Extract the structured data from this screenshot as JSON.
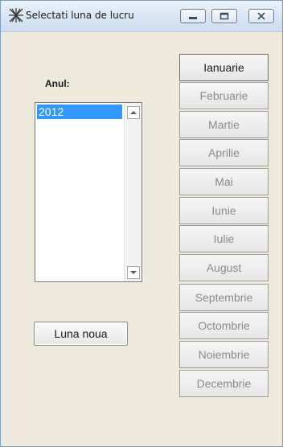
{
  "window": {
    "title": "Selectati luna de lucru",
    "icon": "app-icon"
  },
  "year_label": "Anul:",
  "year_list": {
    "items": [
      "2012"
    ],
    "selected": "2012"
  },
  "new_month_button": "Luna noua",
  "months": [
    {
      "label": "Ianuarie",
      "enabled": true
    },
    {
      "label": "Februarie",
      "enabled": false
    },
    {
      "label": "Martie",
      "enabled": false
    },
    {
      "label": "Aprilie",
      "enabled": false
    },
    {
      "label": "Mai",
      "enabled": false
    },
    {
      "label": "Iunie",
      "enabled": false
    },
    {
      "label": "Iulie",
      "enabled": false
    },
    {
      "label": "August",
      "enabled": false
    },
    {
      "label": "Septembrie",
      "enabled": false
    },
    {
      "label": "Octombrie",
      "enabled": false
    },
    {
      "label": "Noiembrie",
      "enabled": false
    },
    {
      "label": "Decembrie",
      "enabled": false
    }
  ],
  "colors": {
    "selection": "#3399ff",
    "window_bg": "#ede9dd",
    "disabled_text": "#8a8a8a"
  }
}
